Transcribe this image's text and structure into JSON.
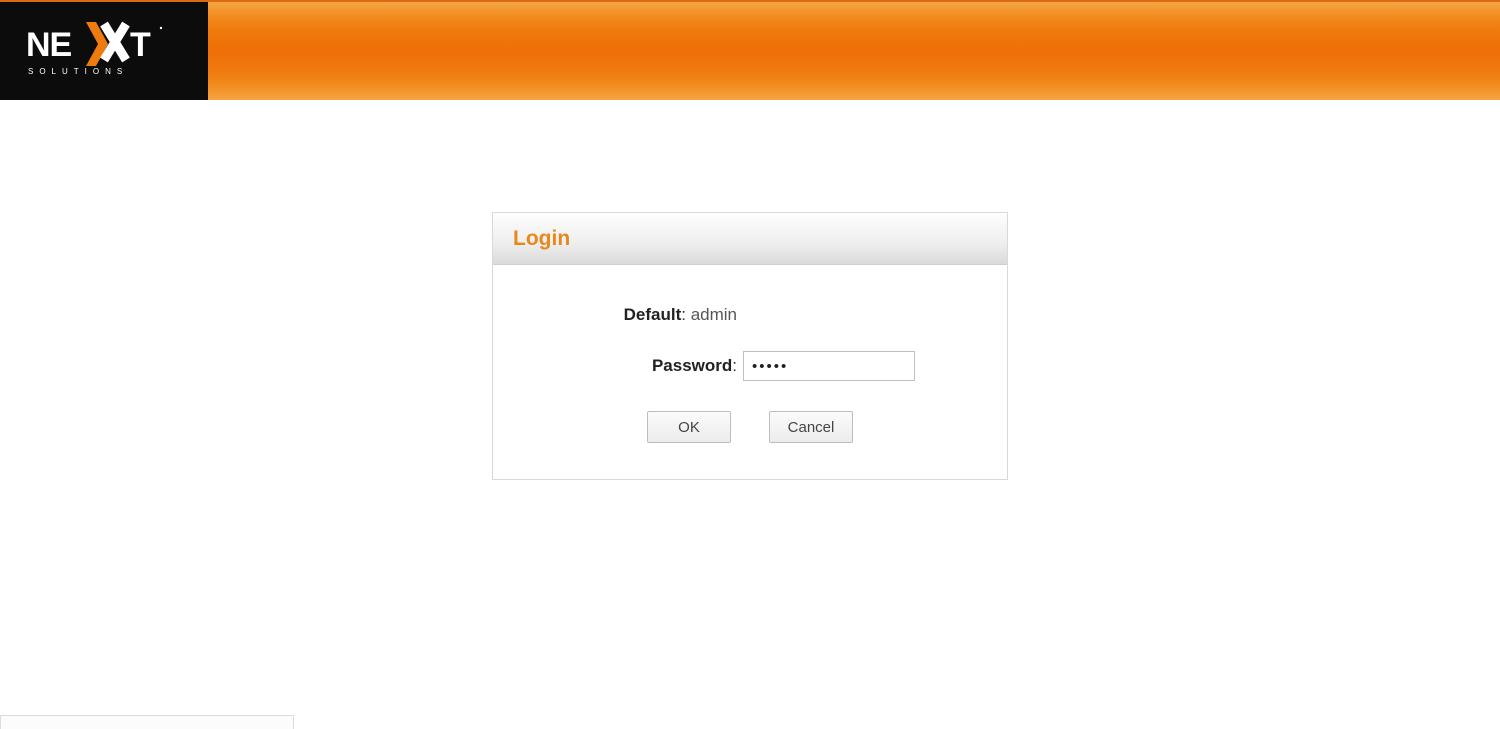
{
  "brand": {
    "name": "NEXXT",
    "tagline": "SOLUTIONS"
  },
  "login": {
    "title": "Login",
    "default_label": "Default",
    "default_value": "admin",
    "password_label": "Password",
    "password_value": "•••••",
    "ok_label": "OK",
    "cancel_label": "Cancel"
  },
  "status": {
    "text": ""
  },
  "colors": {
    "accent": "#e8881c",
    "header_gradient_mid": "#ee6f07"
  }
}
